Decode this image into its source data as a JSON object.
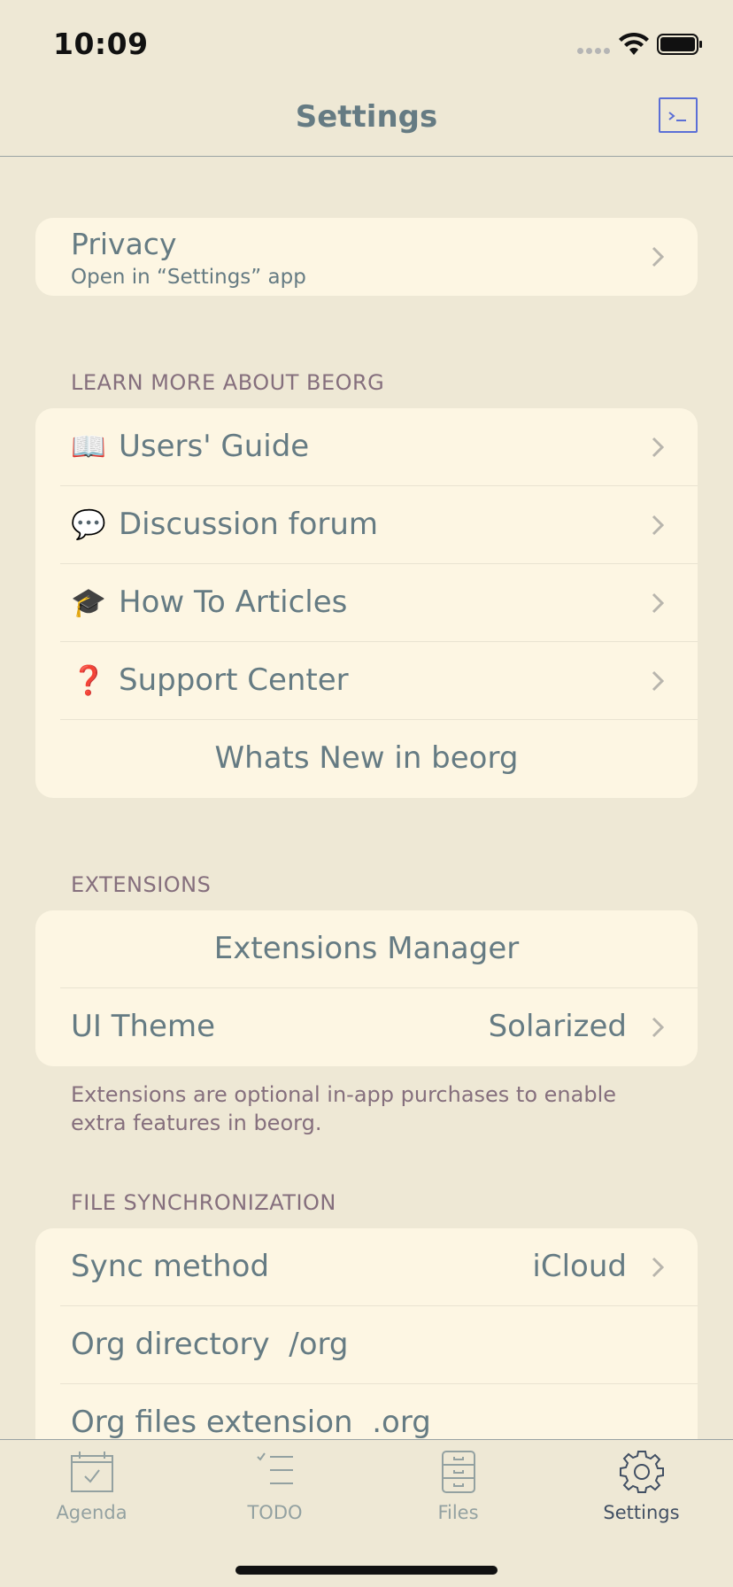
{
  "status_bar": {
    "time": "10:09"
  },
  "nav": {
    "title": "Settings",
    "terminal_icon": "terminal-icon"
  },
  "privacy": {
    "title": "Privacy",
    "subtitle": "Open in “Settings” app"
  },
  "learn_more": {
    "header": "LEARN MORE ABOUT BEORG",
    "items": [
      {
        "emoji": "📖",
        "label": "Users' Guide"
      },
      {
        "emoji": "💬",
        "label": "Discussion forum"
      },
      {
        "emoji": "🎓",
        "label": "How To Articles"
      },
      {
        "emoji": "❓",
        "label": "Support Center"
      }
    ],
    "whats_new": "Whats New in beorg"
  },
  "extensions": {
    "header": "EXTENSIONS",
    "manager": "Extensions Manager",
    "ui_theme_label": "UI Theme",
    "ui_theme_value": "Solarized",
    "footer": "Extensions are optional in-app purchases to enable extra features in beorg."
  },
  "file_sync": {
    "header": "FILE SYNCHRONIZATION",
    "sync_method_label": "Sync method",
    "sync_method_value": "iCloud",
    "org_directory_label": "Org directory",
    "org_directory_value": "/org",
    "org_ext_label": "Org files extension",
    "org_ext_value": ".org"
  },
  "tabs": [
    {
      "label": "Agenda",
      "icon": "calendar-icon"
    },
    {
      "label": "TODO",
      "icon": "checklist-icon"
    },
    {
      "label": "Files",
      "icon": "file-cabinet-icon"
    },
    {
      "label": "Settings",
      "icon": "gear-icon",
      "active": true
    }
  ],
  "colors": {
    "background": "#eee8d5",
    "cell": "#fdf6e3",
    "text": "#657b83",
    "accent": "#5b6fd6"
  }
}
